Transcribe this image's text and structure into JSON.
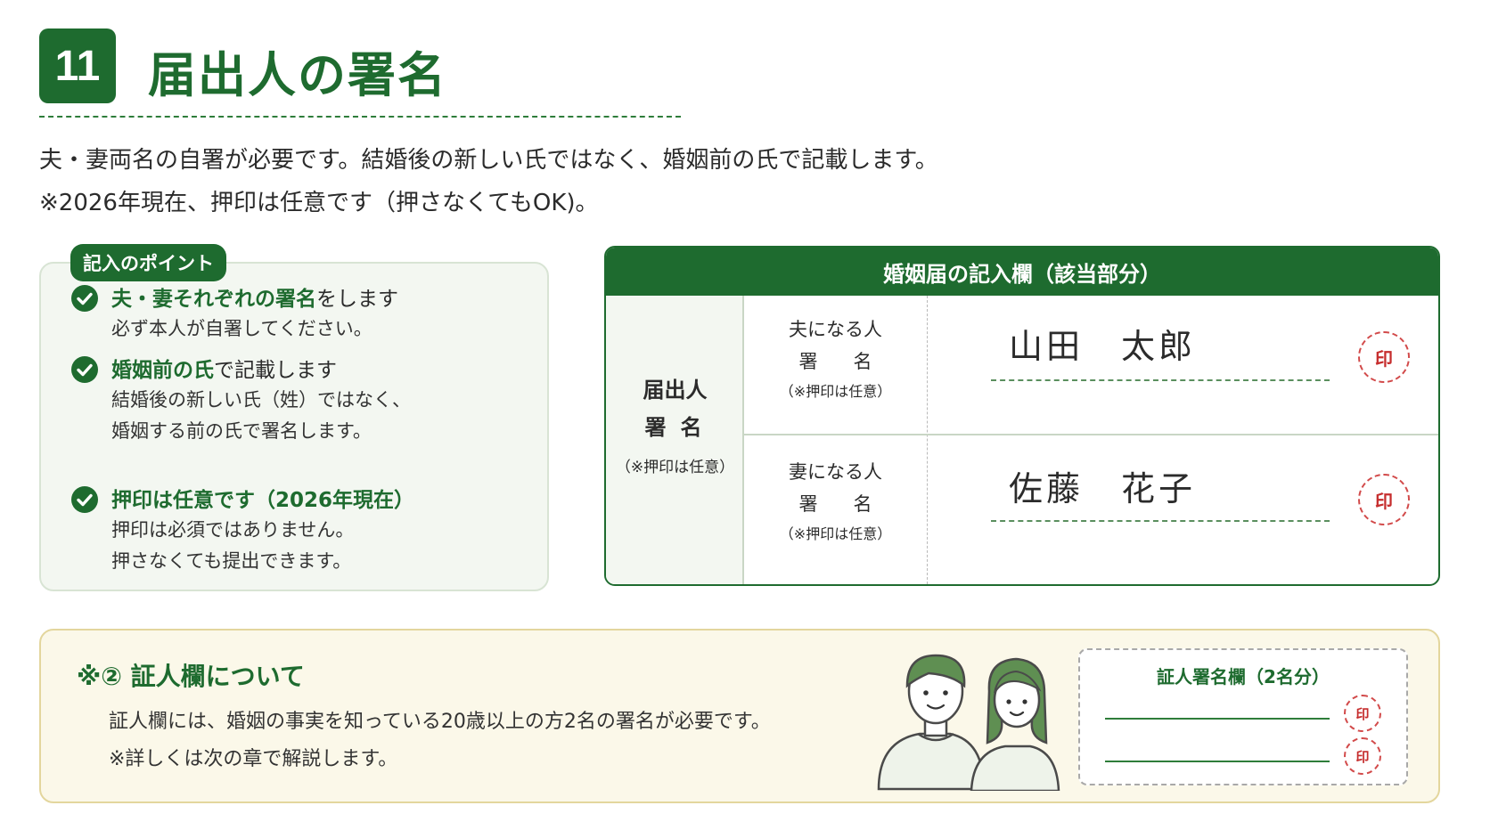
{
  "header": {
    "section_number": "11",
    "title": "届出人の署名"
  },
  "intro": {
    "line1": "夫・妻両名の自署が必要です。結婚後の新しい氏ではなく、婚姻前の氏で記載します。",
    "line2": "※2026年現在、押印は任意です（押さなくてもOK)。"
  },
  "points": {
    "tag": "記入のポイント",
    "items": [
      {
        "highlight": "夫・妻それぞれの署名",
        "rest": "をします",
        "desc1": "必ず本人が自署してください。",
        "desc2": ""
      },
      {
        "highlight": "婚姻前の氏",
        "rest": "で記載します",
        "desc1": "結婚後の新しい氏（姓）ではなく、",
        "desc2": "婚姻する前の氏で署名します。"
      },
      {
        "highlight": "押印は任意です（2026年現在）",
        "rest": "",
        "desc1": "押印は必須ではありません。",
        "desc2": "押さなくても提出できます。"
      }
    ]
  },
  "form": {
    "header": "婚姻届の記入欄（該当部分）",
    "side_line1": "届出人",
    "side_line2": "署名",
    "side_note": "（※押印は任意）",
    "rows": [
      {
        "who": "夫になる人",
        "label": "署名",
        "note": "（※押印は任意）",
        "signature": "山田　太郎",
        "seal": "印"
      },
      {
        "who": "妻になる人",
        "label": "署名",
        "note": "（※押印は任意）",
        "signature": "佐藤　花子",
        "seal": "印"
      }
    ]
  },
  "witness": {
    "title": "※②  証人欄について",
    "desc1": "証人欄には、婚姻の事実を知っている20歳以上の方2名の署名が必要です。",
    "desc2": "※詳しくは次の章で解説します。",
    "form_title": "証人署名欄（2名分）",
    "seal1": "印",
    "seal2": "印"
  },
  "colors": {
    "brand_green": "#1e6b2f",
    "seal_red": "#c62d2d",
    "note_bg": "#fbf8e9"
  }
}
